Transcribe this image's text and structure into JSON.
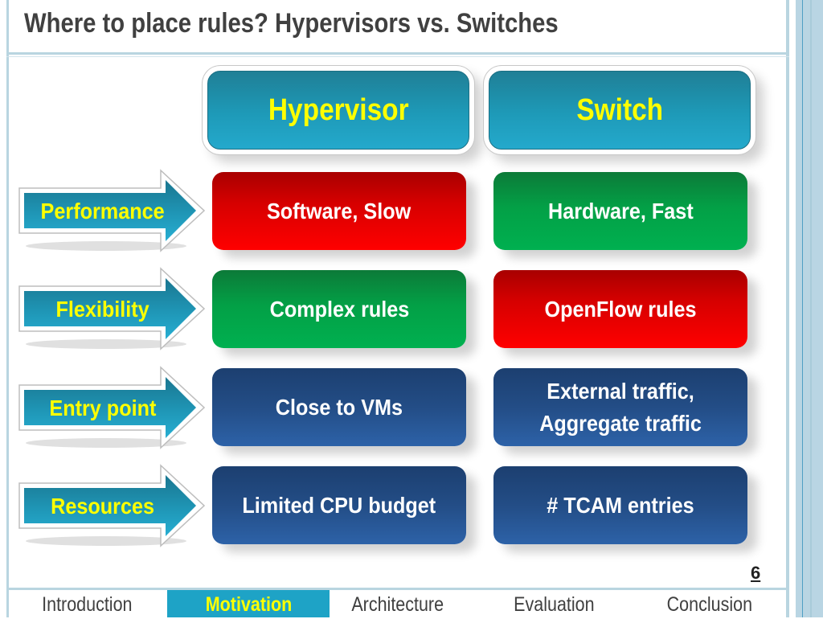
{
  "slide": {
    "title": "Where to place rules? Hypervisors vs. Switches",
    "page_number": "6"
  },
  "columns": [
    {
      "label": "Hypervisor"
    },
    {
      "label": "Switch"
    }
  ],
  "rows": [
    {
      "label": "Performance",
      "cells": [
        {
          "text": "Software, Slow",
          "status": "negative",
          "color": "#e60000"
        },
        {
          "text": "Hardware, Fast",
          "status": "positive",
          "color": "#00a84a"
        }
      ]
    },
    {
      "label": "Flexibility",
      "cells": [
        {
          "text": "Complex rules",
          "status": "positive",
          "color": "#00a84a"
        },
        {
          "text": "OpenFlow rules",
          "status": "negative",
          "color": "#e60000"
        }
      ]
    },
    {
      "label": "Entry point",
      "cells": [
        {
          "text": "Close to VMs",
          "status": "neutral",
          "color": "#234d86"
        },
        {
          "text": "External traffic,\nAggregate traffic",
          "status": "neutral",
          "color": "#234d86"
        }
      ]
    },
    {
      "label": "Resources",
      "cells": [
        {
          "text": "Limited CPU budget",
          "status": "neutral",
          "color": "#234d86"
        },
        {
          "text": "# TCAM entries",
          "status": "neutral",
          "color": "#234d86"
        }
      ]
    }
  ],
  "nav": {
    "items": [
      {
        "label": "Introduction",
        "active": false
      },
      {
        "label": "Motivation",
        "active": true
      },
      {
        "label": "Architecture",
        "active": false
      },
      {
        "label": "Evaluation",
        "active": false
      },
      {
        "label": "Conclusion",
        "active": false
      }
    ]
  },
  "colors": {
    "header_fill": "#1e9ab8",
    "label_text": "#ffff00",
    "negative": "#e60000",
    "positive": "#00a84a",
    "neutral": "#234d86",
    "nav_active": "#1ea3c6"
  }
}
